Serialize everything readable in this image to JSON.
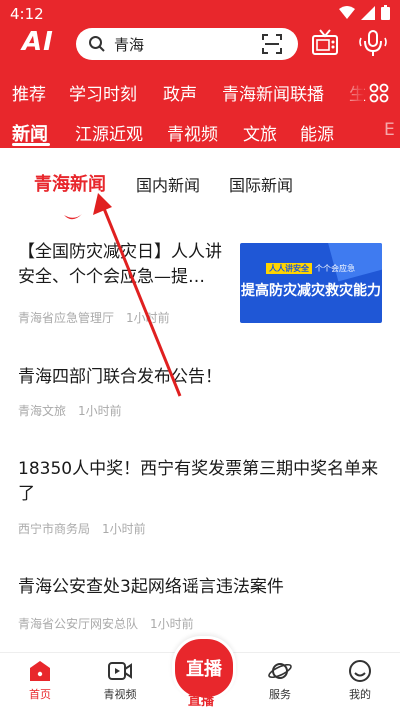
{
  "status_bar": {
    "time": "4:12"
  },
  "header": {
    "logo": "AI",
    "search_text": "青海",
    "channels_row1": [
      "推荐",
      "学习时刻",
      "政声",
      "青海新闻联播",
      "生"
    ],
    "channels_row2": [
      "新闻",
      "江源近观",
      "青视频",
      "文旅",
      "能源",
      "E"
    ],
    "active_channel": "新闻"
  },
  "sub_tabs": [
    "青海新闻",
    "国内新闻",
    "国际新闻"
  ],
  "active_sub_tab": "青海新闻",
  "news": [
    {
      "title": "【全国防灾减灾日】人人讲安全、个个会应急—提…",
      "source": "青海省应急管理厅",
      "time": "1小时前",
      "thumb": {
        "tag_a": "人人讲安全",
        "tag_b": "个个会应急",
        "headline": "提高防灾减灾救灾能力"
      }
    },
    {
      "title": "青海四部门联合发布公告！",
      "source": "青海文旅",
      "time": "1小时前"
    },
    {
      "title": "18350人中奖！西宁有奖发票第三期中奖名单来了",
      "source": "西宁市商务局",
      "time": "1小时前"
    },
    {
      "title": "青海公安查处3起网络谣言违法案件",
      "source": "青海省公安厅网安总队",
      "time": "1小时前"
    }
  ],
  "bottom_nav": {
    "items": [
      "首页",
      "青视频",
      "服务",
      "我的"
    ],
    "live_badge": "直播",
    "live_label": "直播"
  },
  "colors": {
    "brand_red": "#e8272c",
    "thumb_blue": "#1f57d6"
  },
  "icons": [
    "search-icon",
    "scan-icon",
    "tv-icon",
    "mic-icon",
    "grid-menu-icon",
    "home-icon",
    "video-icon",
    "planet-icon",
    "smiley-icon"
  ]
}
